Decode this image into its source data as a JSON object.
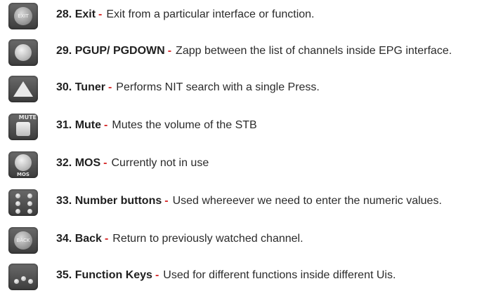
{
  "items": [
    {
      "number": "28.",
      "name": "Exit",
      "description": "Exit from a particular interface or function.",
      "icon": "exit-button-icon",
      "icon_label": "EXIT"
    },
    {
      "number": "29.",
      "name": "PGUP/ PGDOWN",
      "description": "Zapp between the list of channels inside EPG interface.",
      "icon": "page-button-icon"
    },
    {
      "number": "30.",
      "name": "Tuner",
      "description": "Performs NIT search with a single Press.",
      "icon": "tuner-triangle-icon"
    },
    {
      "number": "31.",
      "name": "Mute",
      "description": "Mutes the volume of the STB",
      "icon": "mute-button-icon",
      "icon_label": "MUTE"
    },
    {
      "number": "32.",
      "name": "MOS",
      "description": "Currently not in use",
      "icon": "mos-button-icon",
      "icon_label": "MOS"
    },
    {
      "number": "33.",
      "name": "Number buttons",
      "description": "Used whereever we need to enter the numeric values.",
      "icon": "number-buttons-icon"
    },
    {
      "number": "34.",
      "name": "Back",
      "description": "Return to previously watched channel.",
      "icon": "back-button-icon",
      "icon_label": "BACK"
    },
    {
      "number": "35.",
      "name": "Function Keys",
      "description": "Used for different functions inside different Uis.",
      "icon": "function-keys-icon"
    }
  ],
  "separator": "-",
  "colors": {
    "separator": "#d62a2a",
    "text": "#2b2b2b",
    "icon_bg": "#4a4a4a"
  }
}
